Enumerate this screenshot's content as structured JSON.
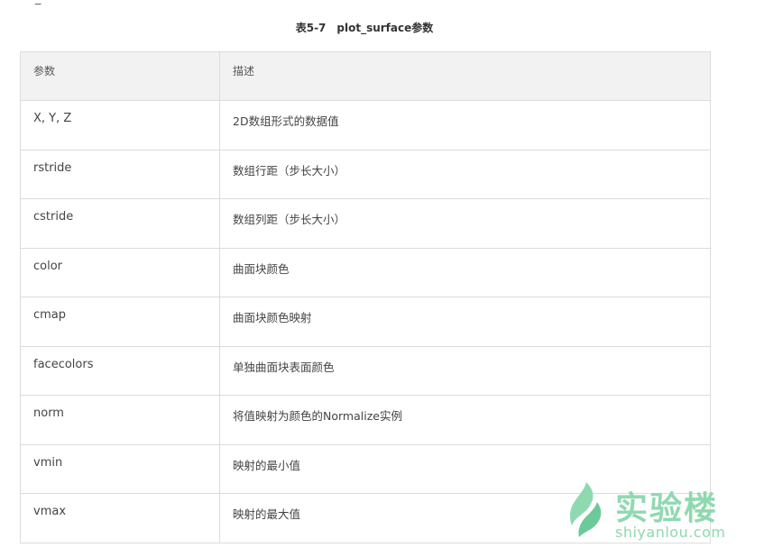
{
  "top_fragment": "- _",
  "caption": "表5-7　plot_surface参数",
  "table": {
    "headers": [
      "参数",
      "描述"
    ],
    "rows": [
      {
        "param": "X, Y, Z",
        "desc": "2D数组形式的数据值"
      },
      {
        "param": "rstride",
        "desc": "数组行距（步长大小）"
      },
      {
        "param": "cstride",
        "desc": "数组列距（步长大小）"
      },
      {
        "param": "color",
        "desc": "曲面块颜色"
      },
      {
        "param": "cmap",
        "desc": "曲面块颜色映射"
      },
      {
        "param": "facecolors",
        "desc": "单独曲面块表面颜色"
      },
      {
        "param": "norm",
        "desc": "将值映射为颜色的Normalize实例"
      },
      {
        "param": "vmin",
        "desc": "映射的最小值"
      },
      {
        "param": "vmax",
        "desc": "映射的最大值"
      }
    ]
  },
  "watermark": {
    "icon": "leaf-logo-icon",
    "name_cn": "实验楼",
    "name_en": "shiyanlou.com",
    "color": "#8fd9b0"
  },
  "colors": {
    "header_bg": "#f2f2f2",
    "border": "#dcdcdc",
    "text": "#444444"
  }
}
